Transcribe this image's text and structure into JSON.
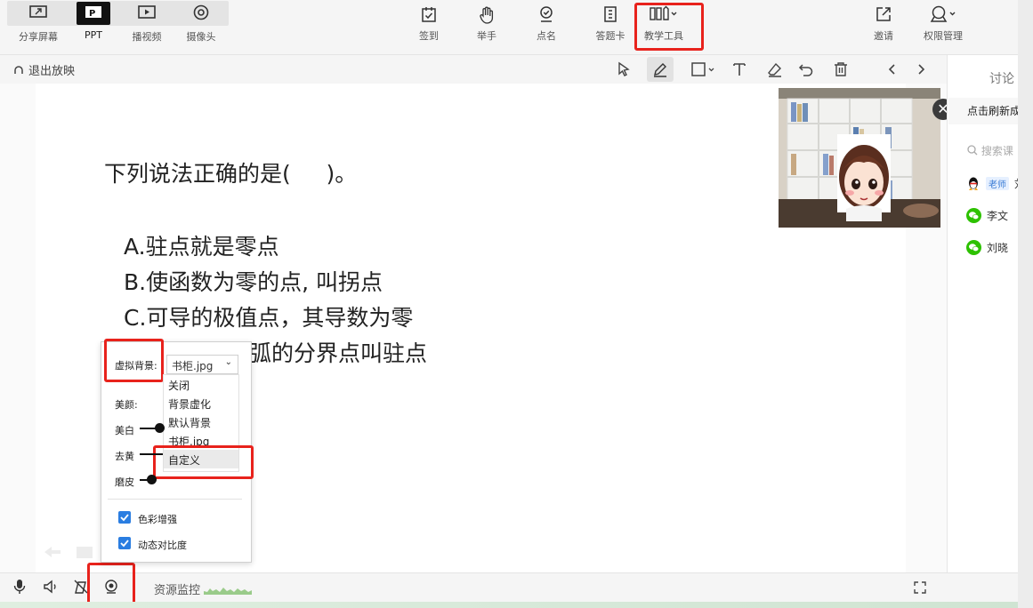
{
  "top_modes": [
    {
      "label": "分享屏幕",
      "icon": "share-screen-icon"
    },
    {
      "label": "PPT",
      "icon": "ppt-icon"
    },
    {
      "label": "播视频",
      "icon": "play-video-icon"
    },
    {
      "label": "摄像头",
      "icon": "camera-icon"
    }
  ],
  "center_tools": [
    {
      "label": "签到",
      "icon": "checkin-icon"
    },
    {
      "label": "举手",
      "icon": "raise-hand-icon"
    },
    {
      "label": "点名",
      "icon": "roll-call-icon"
    },
    {
      "label": "答题卡",
      "icon": "answer-card-icon"
    },
    {
      "label": "教学工具",
      "icon": "teaching-tools-icon"
    }
  ],
  "right_tools": [
    {
      "label": "邀请",
      "icon": "invite-icon"
    },
    {
      "label": "权限管理",
      "icon": "permission-icon"
    }
  ],
  "exit_label": "退出放映",
  "slide": {
    "question": "下列说法正确的是(     )。",
    "options": [
      "A.驻点就是零点",
      "B.使函数为零的点, 叫拐点",
      "C.可导的极值点，其导数为零",
      "弧的分界点叫驻点"
    ]
  },
  "right_panel": {
    "tab": "讨论",
    "refresh": "点击刷新成",
    "search_placeholder": "搜索课",
    "teacher_badge": "老师",
    "teacher_name": "刘",
    "members": [
      "李文",
      "刘晓"
    ]
  },
  "popup": {
    "virtual_bg_label": "虚拟背景:",
    "selected_bg": "书柜.jpg",
    "beauty_label": "美颜:",
    "whiten_label": "美白",
    "denoise_label": "去黄",
    "smooth_label": "磨皮",
    "bg_options": [
      "关闭",
      "背景虚化",
      "默认背景",
      "书柜.jpg",
      "自定义"
    ],
    "checkbox_color": "色彩增强",
    "checkbox_contrast": "动态对比度",
    "levels": {
      "whiten": 0.15,
      "denoise": 0.0,
      "smooth": 0.0
    }
  },
  "bottom": {
    "monitor_label": "资源监控"
  },
  "colors": {
    "highlight": "#e8221c",
    "checkbox": "#2a7de1",
    "wechat": "#2dc100"
  }
}
